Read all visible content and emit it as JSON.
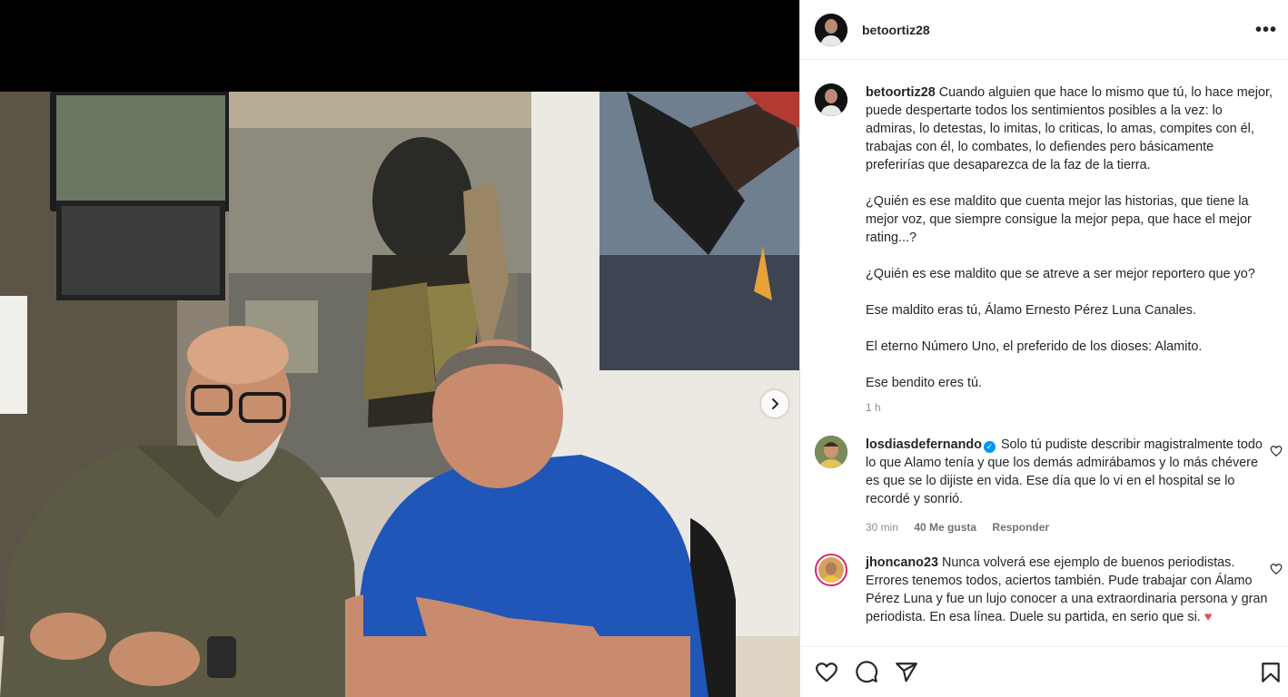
{
  "post": {
    "author": "betoortiz28"
  },
  "caption": {
    "username": "betoortiz28",
    "paragraphs": [
      "Cuando alguien que hace lo mismo que tú, lo hace mejor, puede despertarte todos los sentimientos posibles a la vez: lo admiras, lo detestas, lo imitas, lo criticas, lo amas, compites con él, trabajas con él, lo combates, lo defiendes pero básicamente preferirías que desaparezca de la faz de la tierra.",
      "¿Quién es ese maldito que cuenta mejor las historias, que tiene la mejor voz, que siempre consigue la mejor pepa, que hace el mejor rating...?",
      "¿Quién es ese maldito que se atreve a ser mejor reportero que yo?",
      "Ese maldito eras tú, Álamo Ernesto Pérez Luna Canales.",
      "El eterno Número Uno, el preferido de los dioses: Alamito.",
      "Ese bendito eres tú."
    ],
    "time": "1 h"
  },
  "comments": [
    {
      "username": "losdiasdefernando",
      "verified": true,
      "text": "Solo tú pudiste describir magistralmente todo lo que Alamo tenía y que los demás admirábamos y lo más chévere es que se lo dijiste en vida. Ese día que lo vi en el hospital se lo recordé y sonrió.",
      "time": "30 min",
      "likes": "40 Me gusta",
      "reply": "Responder"
    },
    {
      "username": "jhoncano23",
      "text": "Nunca volverá ese ejemplo de buenos periodistas. Errores tenemos todos, aciertos también. Pude trabajar con Álamo Pérez Luna y fue un lujo conocer a una extraordinaria persona y gran periodista. En esa línea. Duele su partida, en serio que si. ",
      "emoji": "♥"
    }
  ],
  "icons": {
    "more": "more-horizontal-icon",
    "like": "heart-icon",
    "comment": "comment-icon",
    "share": "share-icon",
    "save": "bookmark-icon",
    "next": "chevron-right-icon"
  },
  "colors": {
    "verified": "#0095f6",
    "heart_emoji": "#ed4956",
    "muted": "#8e8e8e"
  }
}
